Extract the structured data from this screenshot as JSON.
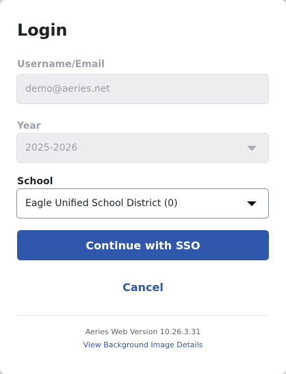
{
  "login": {
    "title": "Login",
    "username": {
      "label": "Username/Email",
      "value": "demo@aeries.net"
    },
    "year": {
      "label": "Year",
      "value": "2025-2026"
    },
    "school": {
      "label": "School",
      "value": "Eagle Unified School District (0)"
    },
    "sso_button": "Continue with SSO",
    "cancel": "Cancel",
    "version": "Aeries Web Version 10.26.3.31",
    "background_link": "View Background Image Details"
  },
  "colors": {
    "primary": "#2f57ac",
    "disabled_bg": "#ebedef",
    "disabled_text": "#9aa0a6"
  }
}
